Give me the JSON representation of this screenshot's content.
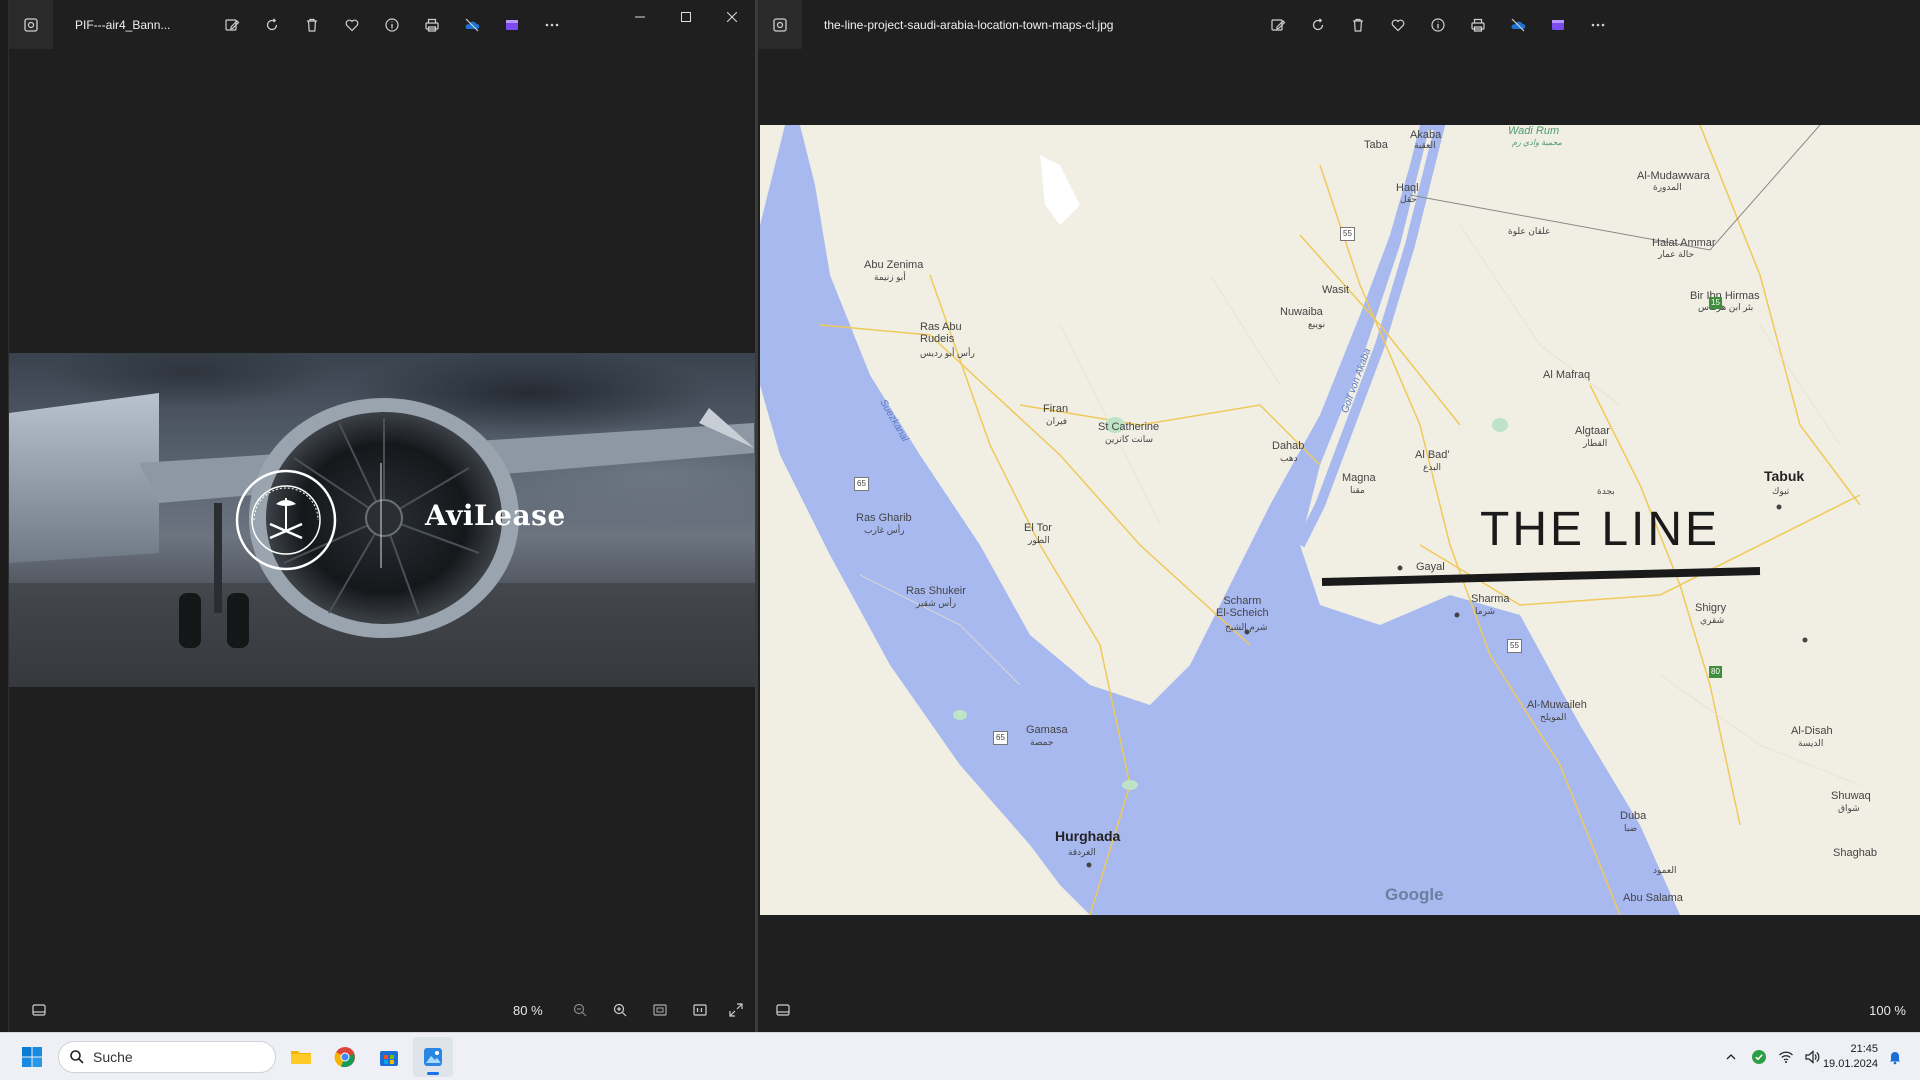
{
  "left_window": {
    "filename": "PIF---air4_Bann...",
    "zoom": "80 %",
    "banner_text": "AviLease",
    "seal_text": "Public Investment Fund"
  },
  "right_window": {
    "filename": "the-line-project-saudi-arabia-location-town-maps-cl.jpg",
    "zoom": "100 %"
  },
  "toolbar_icons": [
    "edit-icon",
    "rotate-icon",
    "delete-icon",
    "favorite-icon",
    "info-icon",
    "print-icon",
    "onedrive-icon",
    "clipchamp-icon",
    "more-icon"
  ],
  "map": {
    "title": "THE LINE",
    "attribution": "Google",
    "labels": {
      "aqaba": "Akaba",
      "aqaba_ar": "العقبة",
      "wadi_rum": "Wadi Rum",
      "wadi_rum_ar": "محمية وادي رم",
      "taba": "Taba",
      "haql": "Haql",
      "haql_ar": "حقل",
      "al_mudawwara": "Al-Mudawwara",
      "al_mudawwara_ar": "المدورة",
      "halat_ammar": "Halat Ammar",
      "halat_ammar_ar": "حالة عمار",
      "bir_ibn_hirmas": "Bir Ibn Hirmas",
      "bir_ibn_hirmas_ar": "بئر ابن هرماس",
      "abu_zenima": "Abu Zenima",
      "abu_zenima_ar": "أبو زنيمة",
      "ras_abu_rudeis": "Ras Abu\nRudeis",
      "ras_abu_rudeis_ar": "رأس أبو رديس",
      "wasit": "Wasit",
      "nuwaiba": "Nuwaiba",
      "nuwaiba_ar": "نويبع",
      "al_mafraq": "Al Mafraq",
      "firan": "Firan",
      "firan_ar": "فيران",
      "st_catherine": "St Catherine",
      "st_catherine_ar": "سانت كاترين",
      "dahab": "Dahab",
      "dahab_ar": "دهب",
      "golf_akaba": "Golf von Akaba",
      "suezkanal": "Suezkanal",
      "algtaar": "Algtaar",
      "algtaar_ar": "القطار",
      "al_bad": "Al Bad'",
      "al_bad_ar": "البدع",
      "magna": "Magna",
      "magna_ar": "مقنا",
      "tabuk": "Tabuk",
      "tabuk_ar": "تبوك",
      "bijda_ar": "بجدة",
      "ras_gharib": "Ras Gharib",
      "ras_gharib_ar": "رأس غارب",
      "el_tor": "El Tor",
      "el_tor_ar": "الطور",
      "gayal": "Gayal",
      "sharma": "Sharma",
      "sharma_ar": "شرما",
      "ras_shukeir": "Ras Shukeir",
      "ras_shukeir_ar": "رأس شقير",
      "sharm": "Scharm\nEl-Scheich",
      "sharm_ar": "شرم الشيخ",
      "shigry": "Shigry",
      "shigry_ar": "شقري",
      "al_muwaileh": "Al-Muwaileh",
      "al_muwaileh_ar": "المويلح",
      "gamasa": "Gamasa",
      "gamasa_ar": "جمصة",
      "al_disah": "Al-Disah",
      "al_disah_ar": "الديسة",
      "shuwaq": "Shuwaq",
      "shuwaq_ar": "شواق",
      "duba": "Duba",
      "duba_ar": "ضبا",
      "hurghada": "Hurghada",
      "hurghada_ar": "الغردقة",
      "shaghab": "Shaghab",
      "abu_salama": "Abu Salama",
      "al_aamood_ar": "العمود",
      "ilfan_ar": "علقان علوة",
      "r55a": "55",
      "r65a": "65",
      "r65b": "65",
      "r55b": "55",
      "r15": "15",
      "r80": "80"
    }
  },
  "taskbar": {
    "search_placeholder": "Suche",
    "time": "21:45",
    "date": "19.01.2024"
  }
}
